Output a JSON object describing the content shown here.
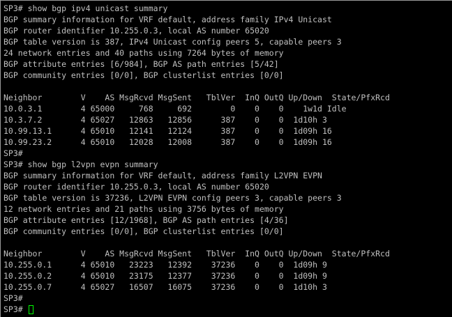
{
  "terminal": {
    "lines": [
      "SP3# show bgp ipv4 unicast summary",
      "BGP summary information for VRF default, address family IPv4 Unicast",
      "BGP router identifier 10.255.0.3, local AS number 65020",
      "BGP table version is 387, IPv4 Unicast config peers 5, capable peers 3",
      "24 network entries and 40 paths using 7264 bytes of memory",
      "BGP attribute entries [6/984], BGP AS path entries [5/42]",
      "BGP community entries [0/0], BGP clusterlist entries [0/0]",
      "",
      "Neighbor        V    AS MsgRcvd MsgSent   TblVer  InQ OutQ Up/Down  State/PfxRcd",
      "10.0.3.1        4 65000     768     692        0    0    0    1w1d Idle",
      "10.3.7.2        4 65027   12863   12856      387    0    0  1d10h 3",
      "10.99.13.1      4 65010   12141   12124      387    0    0  1d09h 16",
      "10.99.23.2      4 65010   12028   12008      387    0    0  1d09h 16",
      "SP3#",
      "SP3# show bgp l2vpn evpn summary",
      "BGP summary information for VRF default, address family L2VPN EVPN",
      "BGP router identifier 10.255.0.3, local AS number 65020",
      "BGP table version is 37236, L2VPN EVPN config peers 3, capable peers 3",
      "12 network entries and 21 paths using 3756 bytes of memory",
      "BGP attribute entries [12/1968], BGP AS path entries [4/36]",
      "BGP community entries [0/0], BGP clusterlist entries [0/0]",
      "",
      "Neighbor        V    AS MsgRcvd MsgSent   TblVer  InQ OutQ Up/Down  State/PfxRcd",
      "10.255.0.1      4 65010   23223   12392    37236    0    0  1d09h 9",
      "10.255.0.2      4 65010   23175   12377    37236    0    0  1d09h 9",
      "10.255.0.7      4 65027   16507   16075    37236    0    0  1d10h 3",
      "SP3#"
    ],
    "prompt": "SP3# ",
    "cursor_color": "#00ff00",
    "text_color": "#c0c0c0",
    "background_color": "#000000"
  }
}
